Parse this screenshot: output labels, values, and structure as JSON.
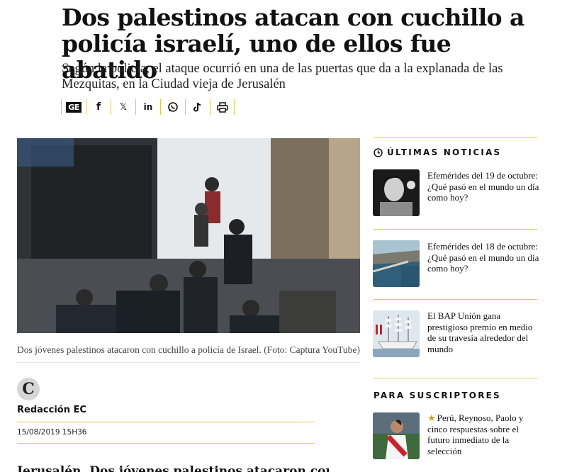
{
  "article": {
    "headline": "Dos palestinos atacan con cuchillo a policía israelí, uno de ellos fue abatido",
    "subheadline": "Según la policía, el ataque ocurrió en una de las puertas que da a la explanada de las Mezquitas, en la Ciudad vieja de Jerusalén",
    "share_buttons": [
      {
        "icon": "ge-logo-icon",
        "label": "GE"
      },
      {
        "icon": "facebook-icon",
        "label": "f"
      },
      {
        "icon": "x-icon",
        "label": "𝕏"
      },
      {
        "icon": "linkedin-icon",
        "label": "in"
      },
      {
        "icon": "whatsapp-icon"
      },
      {
        "icon": "tiktok-icon"
      },
      {
        "icon": "print-icon"
      }
    ],
    "photo_caption": "Dos jóvenes palestinos atacaron con cuchillo a policía de Israel. (Foto: Captura YouTube)",
    "author": {
      "avatar_letter": "C",
      "name": "Redacción EC"
    },
    "published": "15/08/2019 15H36",
    "body_start": "Jerusalén. Dos jóvenes palestinos atacaron con cuchillo"
  },
  "sidebar": {
    "latest_news_title": "ÚLTIMAS NOTICIAS",
    "latest_news": [
      {
        "title": "Efemérides del 19 de octubre: ¿Qué pasó en el mundo un día como hoy?"
      },
      {
        "title": "Efemérides del 18 de octubre: ¿Qué pasó en el mundo un día como hoy?"
      },
      {
        "title": "El BAP Unión gana prestigioso premio en medio de su travesía alrededor del mundo"
      }
    ],
    "subscribers_title": "PARA SUSCRIPTORES",
    "subscribers_news": [
      {
        "title": "Perú, Reynoso, Paolo y cinco respuestas sobre el futuro inmediato de la selección",
        "premium_icon": "star-icon"
      }
    ]
  },
  "colors": {
    "accent_gold": "#e8c84a",
    "premium_star": "#c9a22e",
    "text": "#111111"
  }
}
